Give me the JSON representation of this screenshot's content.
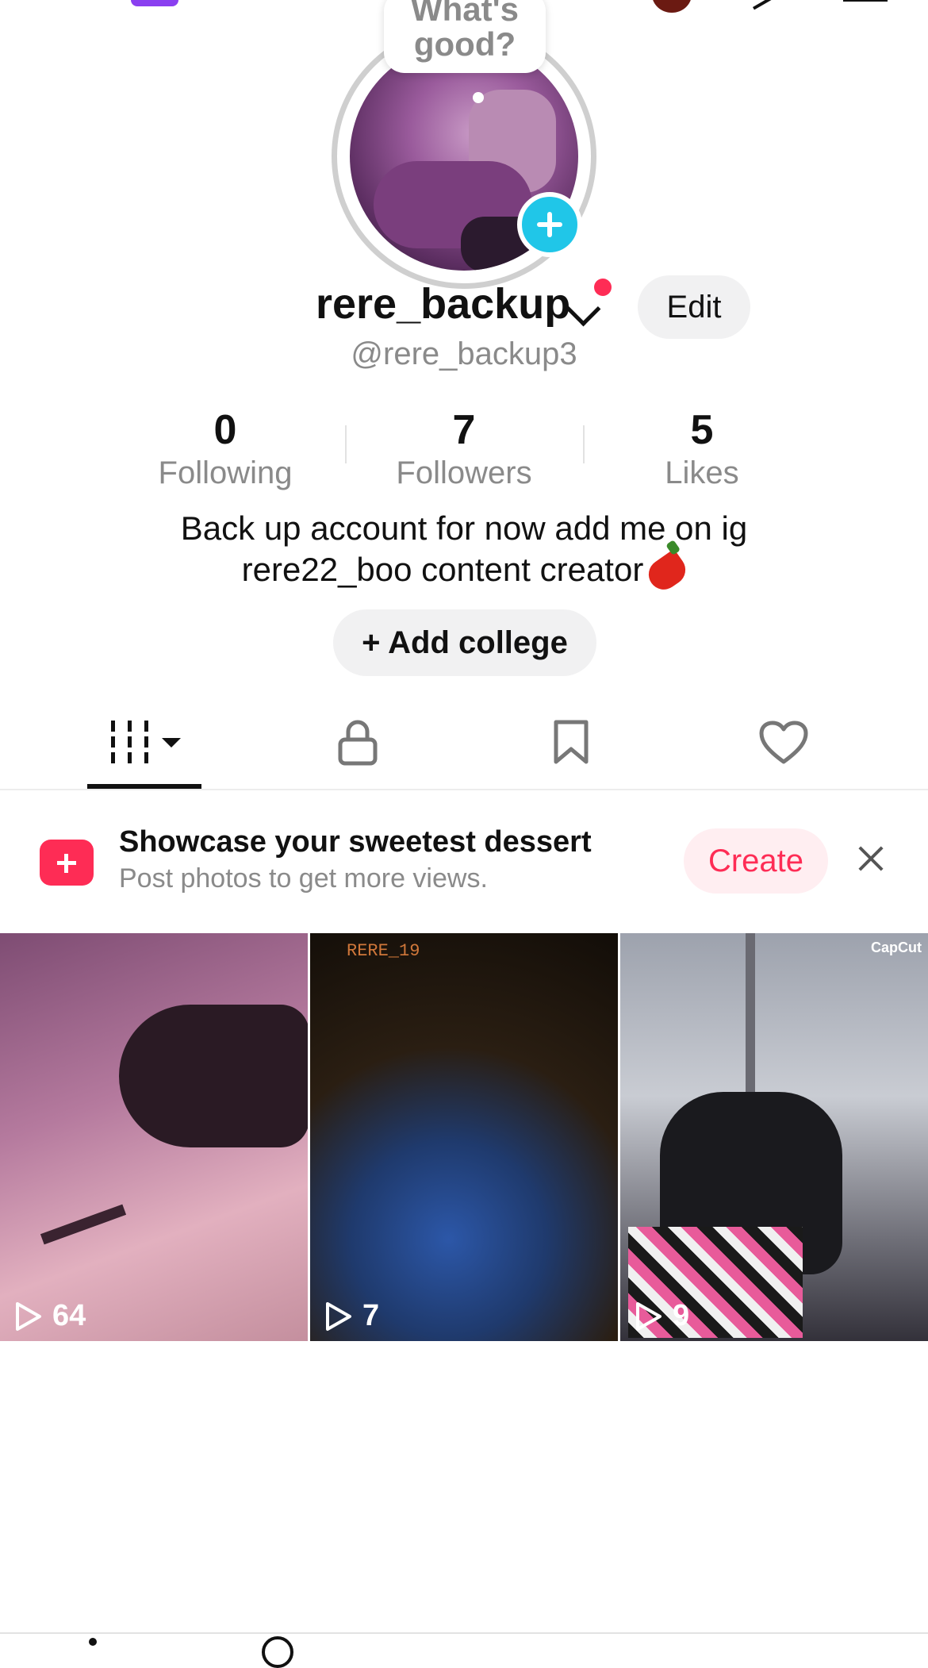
{
  "bubble": {
    "line1": "What's",
    "line2": "good?"
  },
  "profile": {
    "name": "rere_backup",
    "handle": "@rere_backup3",
    "edit_label": "Edit",
    "bio_line1": "Back up account for now add me on ig",
    "bio_line2": "rere22_boo content creator",
    "add_college_label": "+ Add college"
  },
  "stats": [
    {
      "value": "0",
      "label": "Following"
    },
    {
      "value": "7",
      "label": "Followers"
    },
    {
      "value": "5",
      "label": "Likes"
    }
  ],
  "tabs": [
    {
      "icon": "grid-icon",
      "selected": true
    },
    {
      "icon": "lock-icon",
      "selected": false
    },
    {
      "icon": "bookmark-icon",
      "selected": false
    },
    {
      "icon": "heart-icon",
      "selected": false
    }
  ],
  "promo": {
    "title": "Showcase your sweetest dessert",
    "subtitle": "Post photos to get more views.",
    "button": "Create"
  },
  "videos": [
    {
      "views": "64"
    },
    {
      "views": "7",
      "overlay_text": "RERE_19"
    },
    {
      "views": "9",
      "watermark": "CapCut"
    }
  ],
  "colors": {
    "accent": "#fe2c55",
    "badge": "#20c6e8",
    "muted_text": "#8a8a8a"
  }
}
